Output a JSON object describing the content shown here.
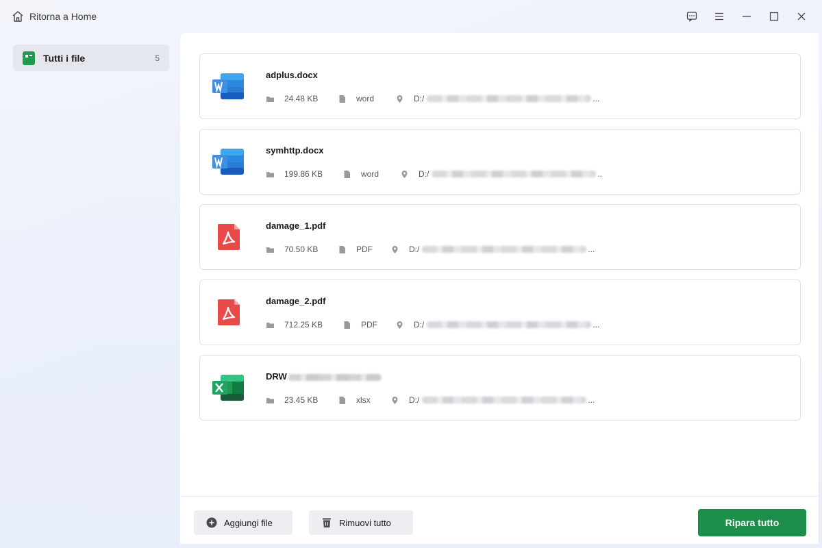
{
  "titlebar": {
    "home_label": "Ritorna a Home",
    "icons": [
      "home-icon",
      "feedback-icon",
      "menu-icon",
      "minimize-icon",
      "maximize-icon",
      "close-icon"
    ]
  },
  "sidebar": {
    "items": [
      {
        "label": "Tutti i file",
        "count": "5",
        "icon": "file-group-icon",
        "selected": true
      }
    ]
  },
  "files": [
    {
      "name": "adplus.docx",
      "size": "24.48 KB",
      "type": "word",
      "path": "D:/",
      "ellipsis": "...",
      "icon": "word-icon"
    },
    {
      "name": "symhttp.docx",
      "size": "199.86 KB",
      "type": "word",
      "path": "D:/",
      "ellipsis": "..",
      "icon": "word-icon"
    },
    {
      "name": "damage_1.pdf",
      "size": "70.50 KB",
      "type": "PDF",
      "path": "D:/",
      "ellipsis": "...",
      "icon": "pdf-icon"
    },
    {
      "name": "damage_2.pdf",
      "size": "712.25 KB",
      "type": "PDF",
      "path": "D:/",
      "ellipsis": "...",
      "icon": "pdf-icon"
    },
    {
      "name": "DRW",
      "size": "23.45 KB",
      "type": "xlsx",
      "path": "D:/",
      "ellipsis": "...",
      "icon": "excel-icon"
    }
  ],
  "bottom": {
    "add_label": "Aggiungi file",
    "remove_label": "Rimuovi tutto",
    "repair_label": "Ripara tutto"
  },
  "colors": {
    "accent_green": "#1b8f4a",
    "word_blue": "#2b7cd3",
    "pdf_red": "#e84a4a",
    "excel_green": "#1f9a4e"
  }
}
